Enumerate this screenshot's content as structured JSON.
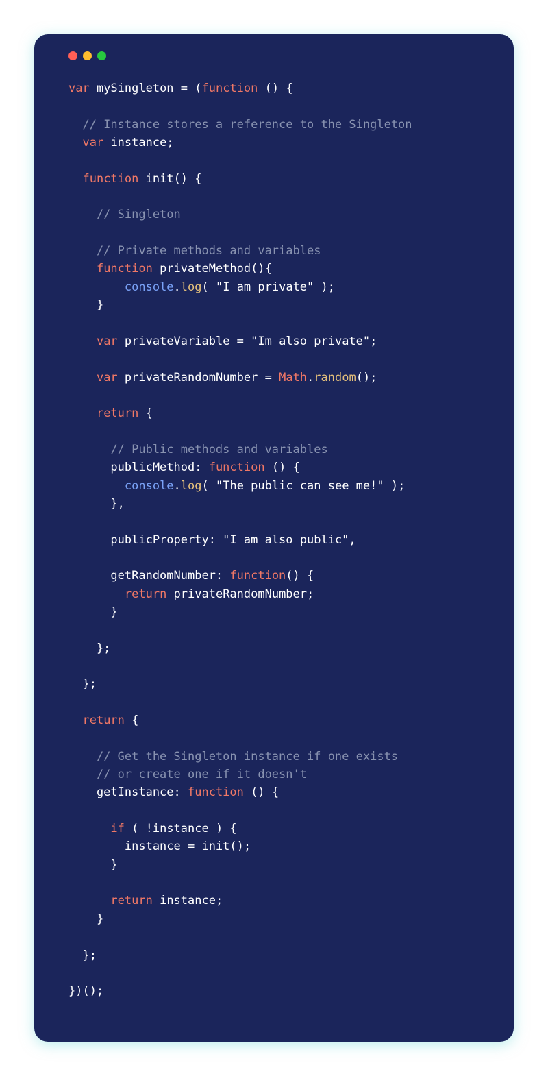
{
  "colors": {
    "background": "#1b255b",
    "keyword": "#f07866",
    "comment": "#8892b0",
    "text": "#ffffff",
    "console": "#7aa2f7",
    "method": "#e5c07b",
    "dotRed": "#ff5f56",
    "dotYellow": "#ffbd2e",
    "dotGreen": "#27c93f"
  },
  "tokens": {
    "t01": "var",
    "t02": " mySingleton = (",
    "t03": "function",
    "t04": " () {",
    "t05": "  // Instance stores a reference to the Singleton",
    "t06": "  ",
    "t07": "var",
    "t08": " instance;",
    "t09": "  ",
    "t10": "function",
    "t11": " init() {",
    "t12": "    // Singleton",
    "t13": "    // Private methods and variables",
    "t14": "    ",
    "t15": "function",
    "t16": " privateMethod(){",
    "t17": "        ",
    "t18": "console",
    "t19": ".",
    "t20": "log",
    "t21": "( \"I am private\" );",
    "t22": "    }",
    "t23": "    ",
    "t24": "var",
    "t25": " privateVariable = \"Im also private\";",
    "t26": "    ",
    "t27": "var",
    "t28": " privateRandomNumber = ",
    "t29": "Math",
    "t30": ".",
    "t31": "random",
    "t32": "();",
    "t33": "    ",
    "t34": "return",
    "t35": " {",
    "t36": "      // Public methods and variables",
    "t37": "      publicMethod: ",
    "t38": "function",
    "t39": " () {",
    "t40": "        ",
    "t41": "console",
    "t42": ".",
    "t43": "log",
    "t44": "( \"The public can see me!\" );",
    "t45": "      },",
    "t46": "      publicProperty: \"I am also public\",",
    "t47": "      getRandomNumber: ",
    "t48": "function",
    "t49": "() {",
    "t50": "        ",
    "t51": "return",
    "t52": " privateRandomNumber;",
    "t53": "      }",
    "t54": "    };",
    "t55": "  };",
    "t56": "  ",
    "t57": "return",
    "t58": " {",
    "t59": "    // Get the Singleton instance if one exists",
    "t60": "    // or create one if it doesn't",
    "t61": "    getInstance: ",
    "t62": "function",
    "t63": " () {",
    "t64": "      ",
    "t65": "if",
    "t66": " ( !instance ) {",
    "t67": "        instance = init();",
    "t68": "      }",
    "t69": "      ",
    "t70": "return",
    "t71": " instance;",
    "t72": "    }",
    "t73": "  };",
    "t74": "})();"
  }
}
